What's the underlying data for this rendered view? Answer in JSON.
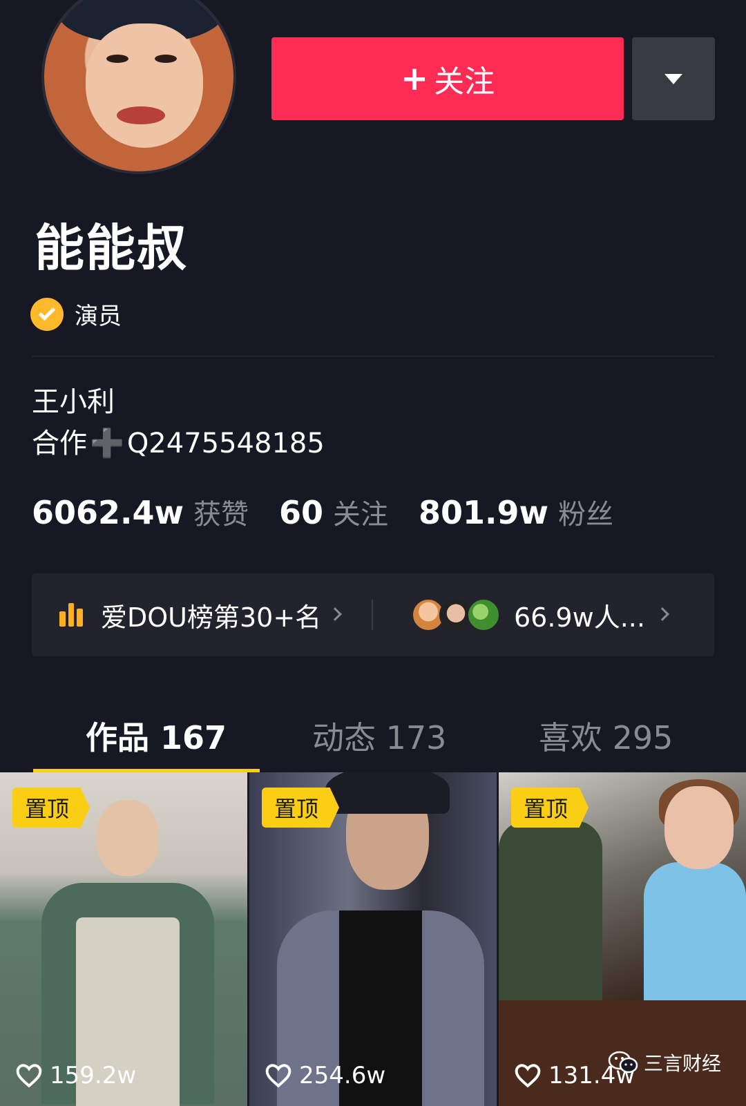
{
  "header": {
    "follow_label": "关注",
    "follow_plus": "+",
    "more_icon": "caret-down-icon"
  },
  "profile": {
    "name": "能能叔",
    "verification": "演员",
    "bio_line1": "王小利",
    "bio_line2_prefix": "合作",
    "bio_line2_plus": "➕",
    "bio_line2_suffix": "Q2475548185"
  },
  "stats": [
    {
      "value": "6062.4w",
      "label": "获赞"
    },
    {
      "value": "60",
      "label": "关注"
    },
    {
      "value": "801.9w",
      "label": "粉丝"
    }
  ],
  "rank": {
    "text": "爱DOU榜第30+名",
    "fans_text": "66.9w人..."
  },
  "tabs": [
    {
      "label": "作品 167",
      "active": true
    },
    {
      "label": "动态 173",
      "active": false
    },
    {
      "label": "喜欢 295",
      "active": false
    }
  ],
  "videos": [
    {
      "pin": "置顶",
      "likes": "159.2w"
    },
    {
      "pin": "置顶",
      "likes": "254.6w"
    },
    {
      "pin": "置顶",
      "likes": "131.4w"
    }
  ],
  "watermark": "三言财经",
  "colors": {
    "background": "#161823",
    "follow": "#fe2c55",
    "accent": "#face15",
    "verified": "#ffb92a"
  }
}
